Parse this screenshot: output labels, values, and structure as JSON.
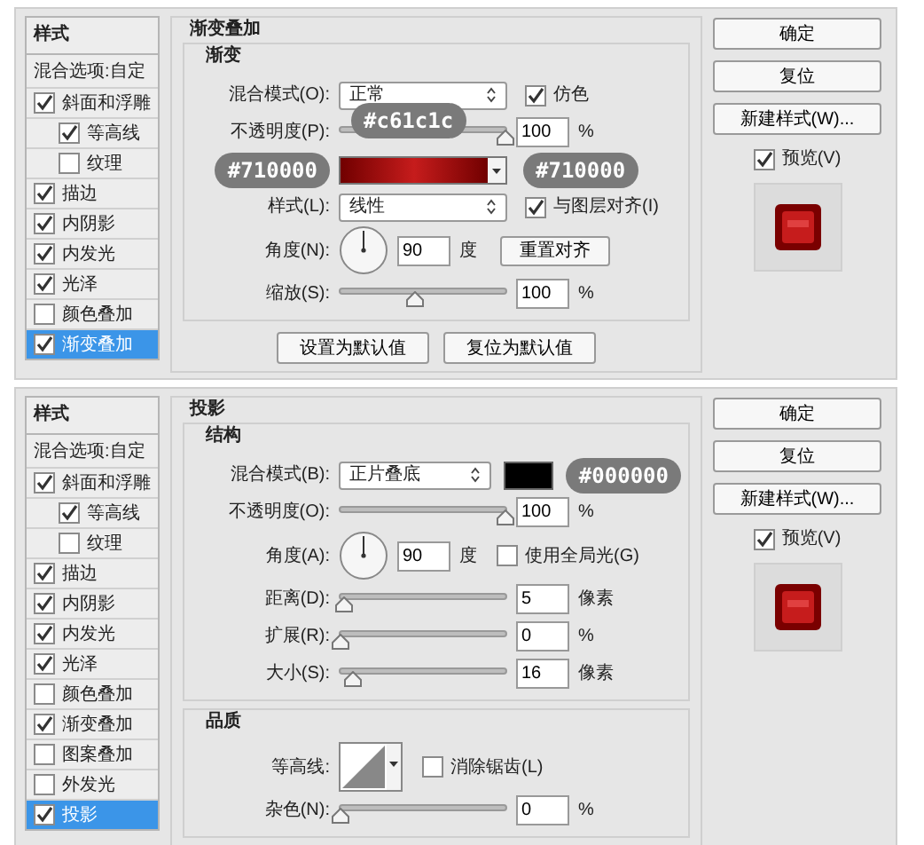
{
  "panels": [
    {
      "styles": {
        "header": "样式",
        "blend_options": "混合选项:自定",
        "items": [
          {
            "label": "斜面和浮雕",
            "checked": true,
            "selected": false,
            "children": [
              {
                "label": "等高线",
                "checked": true,
                "selected": false
              },
              {
                "label": "纹理",
                "checked": false,
                "selected": false
              }
            ]
          },
          {
            "label": "描边",
            "checked": true,
            "selected": false
          },
          {
            "label": "内阴影",
            "checked": true,
            "selected": false
          },
          {
            "label": "内发光",
            "checked": true,
            "selected": false
          },
          {
            "label": "光泽",
            "checked": true,
            "selected": false
          },
          {
            "label": "颜色叠加",
            "checked": false,
            "selected": false
          },
          {
            "label": "渐变叠加",
            "checked": true,
            "selected": true
          }
        ]
      },
      "title": "渐变叠加",
      "groups": [
        {
          "title": "渐变",
          "rows": [
            {
              "kind": "select",
              "label": "混合模式(O):",
              "value": "正常",
              "checkbox": {
                "label": "仿色",
                "checked": true
              }
            },
            {
              "kind": "slider",
              "label": "不透明度(P):",
              "level": 1,
              "value": "100",
              "unit": "%",
              "badges": [
                "#c61c1c"
              ]
            },
            {
              "kind": "gradient",
              "badges": [
                "#710000",
                "#710000"
              ]
            },
            {
              "kind": "select",
              "label": "样式(L):",
              "value": "线性",
              "checkbox": {
                "label": "与图层对齐(I)",
                "checked": true
              }
            },
            {
              "kind": "angle",
              "label": "角度(N):",
              "value": "90",
              "unit": "度",
              "button": "重置对齐"
            },
            {
              "kind": "slider",
              "label": "缩放(S):",
              "level": 0.45,
              "value": "100",
              "unit": "%"
            }
          ]
        }
      ],
      "buttons": [
        "设置为默认值",
        "复位为默认值"
      ],
      "actions": [
        "确定",
        "复位",
        "新建样式(W)..."
      ],
      "preview": {
        "label": "预览(V)",
        "checked": true
      }
    },
    {
      "styles": {
        "header": "样式",
        "blend_options": "混合选项:自定",
        "items": [
          {
            "label": "斜面和浮雕",
            "checked": true,
            "selected": false,
            "children": [
              {
                "label": "等高线",
                "checked": true,
                "selected": false
              },
              {
                "label": "纹理",
                "checked": false,
                "selected": false
              }
            ]
          },
          {
            "label": "描边",
            "checked": true,
            "selected": false
          },
          {
            "label": "内阴影",
            "checked": true,
            "selected": false
          },
          {
            "label": "内发光",
            "checked": true,
            "selected": false
          },
          {
            "label": "光泽",
            "checked": true,
            "selected": false
          },
          {
            "label": "颜色叠加",
            "checked": false,
            "selected": false
          },
          {
            "label": "渐变叠加",
            "checked": true,
            "selected": false
          },
          {
            "label": "图案叠加",
            "checked": false,
            "selected": false
          },
          {
            "label": "外发光",
            "checked": false,
            "selected": false
          },
          {
            "label": "投影",
            "checked": true,
            "selected": true
          }
        ]
      },
      "title": "投影",
      "groups": [
        {
          "title": "结构",
          "rows": [
            {
              "kind": "select_swatch",
              "label": "混合模式(B):",
              "value": "正片叠底",
              "badges": [
                "#000000"
              ]
            },
            {
              "kind": "slider",
              "label": "不透明度(O):",
              "level": 1,
              "value": "100",
              "unit": "%"
            },
            {
              "kind": "angle",
              "label": "角度(A):",
              "value": "90",
              "unit": "度",
              "checkbox": {
                "label": "使用全局光(G)",
                "checked": false
              }
            },
            {
              "kind": "slider",
              "label": "距离(D):",
              "level": 0.02,
              "value": "5",
              "unit": "像素"
            },
            {
              "kind": "slider",
              "label": "扩展(R):",
              "level": 0,
              "value": "0",
              "unit": "%"
            },
            {
              "kind": "slider",
              "label": "大小(S):",
              "level": 0.07,
              "value": "16",
              "unit": "像素"
            }
          ]
        },
        {
          "title": "品质",
          "rows": [
            {
              "kind": "contour",
              "label": "等高线:",
              "checkbox": {
                "label": "消除锯齿(L)",
                "checked": false
              }
            },
            {
              "kind": "slider",
              "label": "杂色(N):",
              "level": 0,
              "value": "0",
              "unit": "%"
            }
          ]
        }
      ],
      "actions": [
        "确定",
        "复位",
        "新建样式(W)..."
      ],
      "preview": {
        "label": "预览(V)",
        "checked": true
      }
    }
  ]
}
